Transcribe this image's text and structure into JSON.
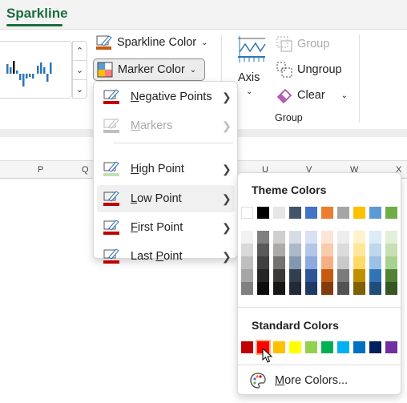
{
  "tab": {
    "label": "Sparkline"
  },
  "ribbon": {
    "sparkline_color": "Sparkline Color",
    "marker_color": "Marker Color",
    "axis": "Axis",
    "group": "Group",
    "ungroup": "Ungroup",
    "clear": "Clear",
    "group_label": "Group"
  },
  "columns": [
    "P",
    "Q",
    "U",
    "V",
    "W",
    "X"
  ],
  "menu": {
    "items": [
      {
        "label": "Negative Points",
        "accel": "N",
        "rest": "egative Points",
        "color": "#c00000",
        "disabled": false
      },
      {
        "label": "Markers",
        "accel": "M",
        "rest": "arkers",
        "color": "#bfbfbf",
        "disabled": true
      },
      {
        "label": "High Point",
        "accel": "H",
        "rest": "igh Point",
        "color": "#c6e0b4",
        "disabled": false
      },
      {
        "label": "Low Point",
        "accel": "L",
        "rest": "ow Point",
        "color": "#c00000",
        "disabled": false,
        "hover": true
      },
      {
        "label": "First Point",
        "accel": "F",
        "rest": "irst Point",
        "color": "#c00000",
        "disabled": false
      },
      {
        "label": "Last Point",
        "pre": "Last ",
        "accel": "P",
        "rest": "oint",
        "color": "#c00000",
        "disabled": false
      }
    ]
  },
  "submenu": {
    "theme_title": "Theme Colors",
    "theme_colors": [
      "#FFFFFF",
      "#000000",
      "#E7E6E6",
      "#44546A",
      "#4472C4",
      "#ED7D31",
      "#A5A5A5",
      "#FFC000",
      "#5B9BD5",
      "#70AD47"
    ],
    "theme_shades": [
      [
        "#F2F2F2",
        "#D9D9D9",
        "#BFBFBF",
        "#A6A6A6",
        "#808080"
      ],
      [
        "#808080",
        "#595959",
        "#404040",
        "#262626",
        "#0D0D0D"
      ],
      [
        "#D0CECE",
        "#AEAAAA",
        "#767171",
        "#3B3838",
        "#161616"
      ],
      [
        "#D6DCE4",
        "#ACB9CA",
        "#8497B0",
        "#333F4F",
        "#222B35"
      ],
      [
        "#D9E1F2",
        "#B4C6E7",
        "#8EA9DB",
        "#2F5597",
        "#203864"
      ],
      [
        "#FCE4D6",
        "#F8CBAD",
        "#F4B084",
        "#C65911",
        "#833C0C"
      ],
      [
        "#EDEDED",
        "#DBDBDB",
        "#C9C9C9",
        "#7B7B7B",
        "#525252"
      ],
      [
        "#FFF2CC",
        "#FFE699",
        "#FFD966",
        "#BF8F00",
        "#806000"
      ],
      [
        "#DDEBF7",
        "#BDD7EE",
        "#9BC2E6",
        "#2F75B5",
        "#1F4E78"
      ],
      [
        "#E2EFDA",
        "#C6E0B4",
        "#A9D08E",
        "#548235",
        "#375623"
      ]
    ],
    "standard_title": "Standard Colors",
    "standard_colors": [
      "#C00000",
      "#FF0000",
      "#FFC000",
      "#FFFF00",
      "#92D050",
      "#00B050",
      "#00B0F0",
      "#0070C0",
      "#002060",
      "#7030A0"
    ],
    "selected_standard": 1,
    "more_colors": {
      "accel": "M",
      "rest": "ore Colors..."
    }
  }
}
